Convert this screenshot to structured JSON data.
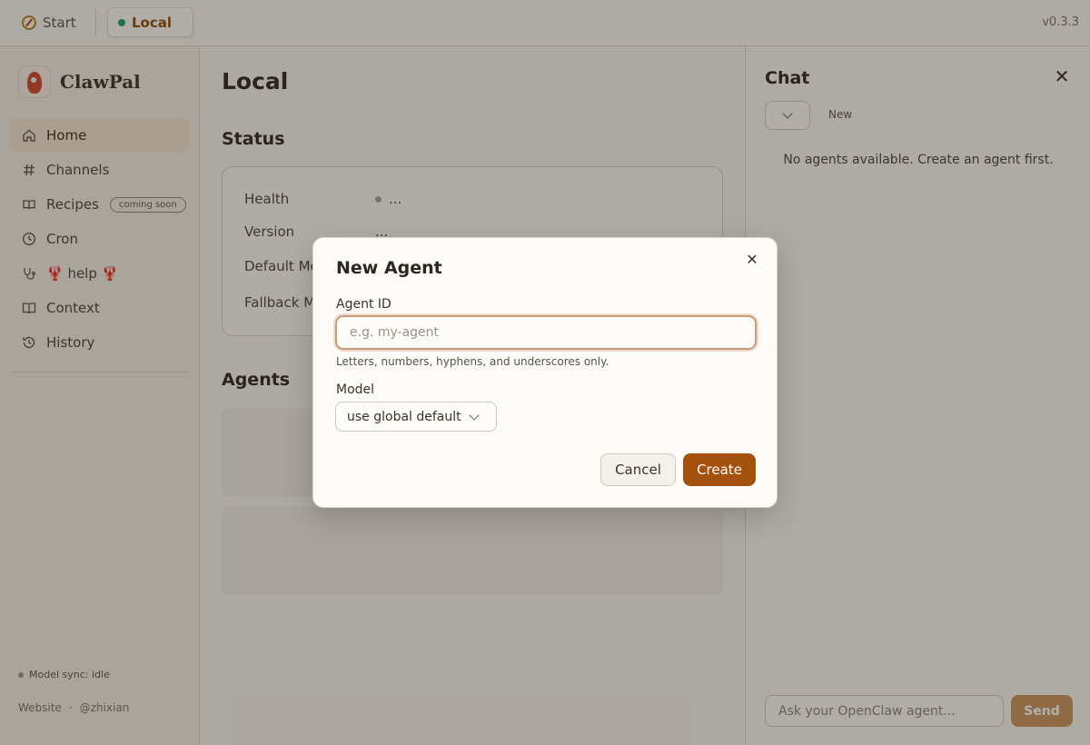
{
  "topbar": {
    "tab_start": "Start",
    "tab_local": "Local",
    "version": "v0.3.3"
  },
  "sidebar": {
    "brand": "ClawPal",
    "items": [
      {
        "label": "Home",
        "icon": "home-icon",
        "active": true
      },
      {
        "label": "Channels",
        "icon": "hash-icon"
      },
      {
        "label": "Recipes",
        "icon": "book-open-icon",
        "badge": "coming soon"
      },
      {
        "label": "Cron",
        "icon": "clock-icon"
      },
      {
        "label": "🦞 help 🦞",
        "icon": "stethoscope-icon"
      },
      {
        "label": "Context",
        "icon": "book-icon"
      },
      {
        "label": "History",
        "icon": "history-icon"
      }
    ],
    "model_sync": "Model sync: idle",
    "links": {
      "website": "Website",
      "separator": "·",
      "author": "@zhixian"
    }
  },
  "main": {
    "title": "Local",
    "status_heading": "Status",
    "status_rows": [
      {
        "label": "Health",
        "value": "..."
      },
      {
        "label": "Version",
        "value": "..."
      },
      {
        "label": "Default Mo",
        "value": ""
      },
      {
        "label": "Fallback Mo",
        "value": ""
      }
    ],
    "agents_heading": "Agents"
  },
  "chat": {
    "title": "Chat",
    "close_glyph": "✕",
    "new_label": "New",
    "empty_text": "No agents available. Create an agent first.",
    "input_placeholder": "Ask your OpenClaw agent...",
    "send_label": "Send"
  },
  "modal": {
    "title": "New Agent",
    "close_glyph": "✕",
    "agent_id_label": "Agent ID",
    "agent_id_placeholder": "e.g. my-agent",
    "agent_id_value": "",
    "hint": "Letters, numbers, hyphens, and underscores only.",
    "model_label": "Model",
    "model_value": "use global default",
    "cancel_label": "Cancel",
    "create_label": "Create"
  },
  "colors": {
    "accent": "#a3510c",
    "status_online": "#1f9a62"
  }
}
